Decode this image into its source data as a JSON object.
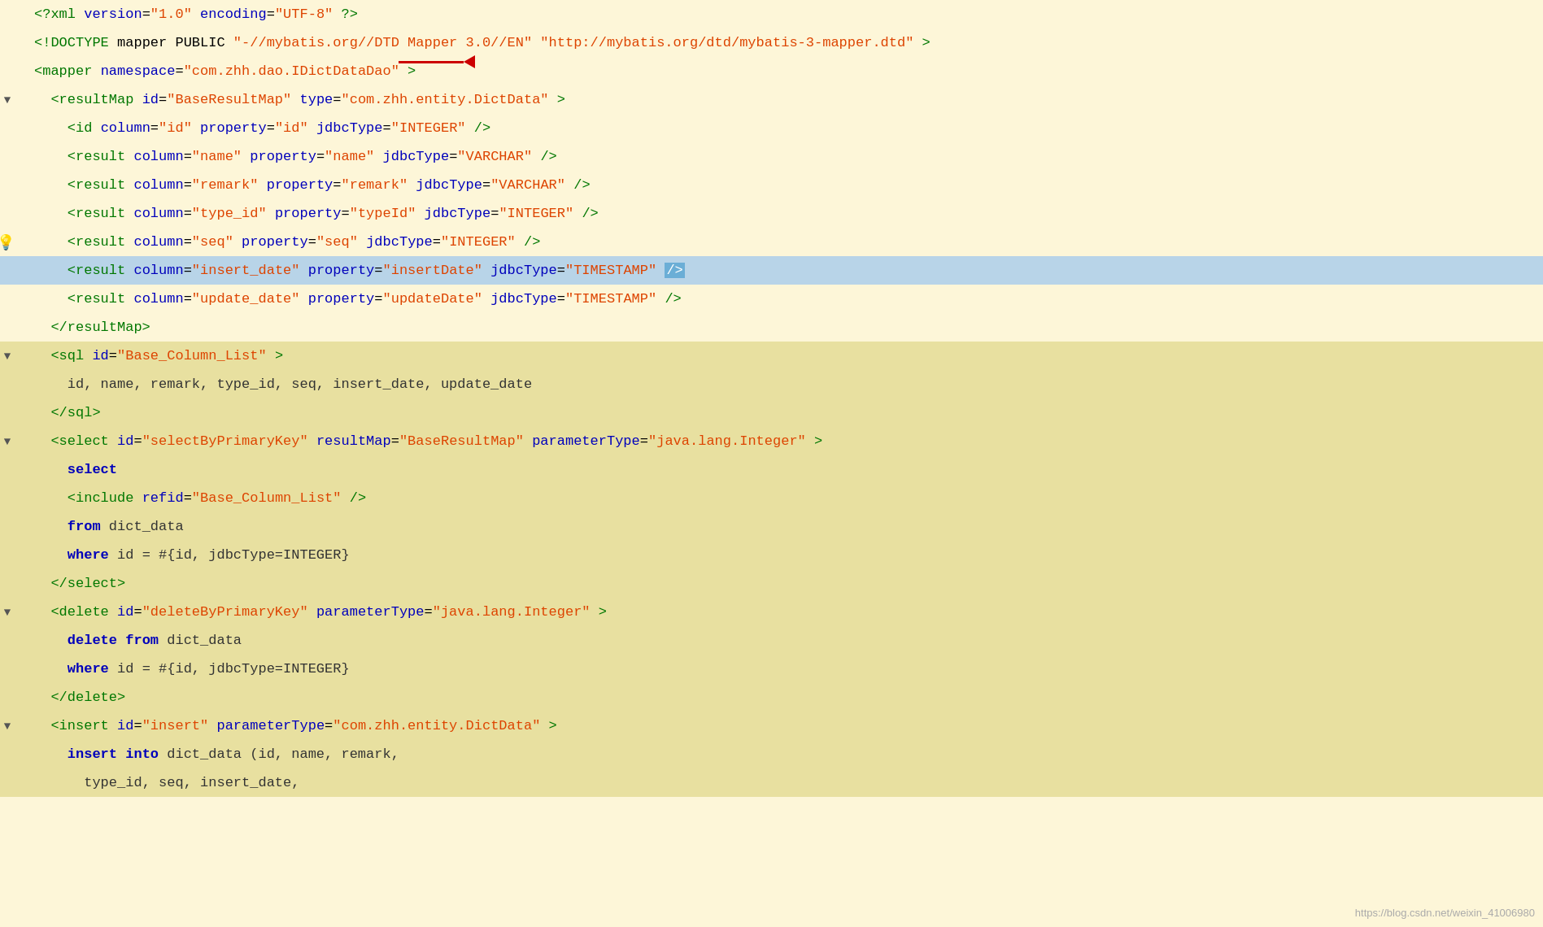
{
  "watermark": "https://blog.csdn.net/weixin_41006980",
  "lines": [
    {
      "id": 1,
      "gutter": "",
      "fold": "",
      "content": "<?xml version=\"1.0\" encoding=\"UTF-8\" ?>",
      "highlighted": false,
      "selected": false,
      "indent": 0,
      "hasBulb": false
    },
    {
      "id": 2,
      "gutter": "",
      "fold": "",
      "content": "<!DOCTYPE mapper PUBLIC \"-//mybatis.org//DTD Mapper 3.0//EN\" \"http://mybatis.org/dtd/mybatis-3-mapper.dtd\" >",
      "highlighted": false,
      "selected": false,
      "indent": 0,
      "hasBulb": false
    },
    {
      "id": 3,
      "gutter": "",
      "fold": "",
      "content": "<mapper namespace=\"com.zhh.dao.IDictDataDao\" >",
      "highlighted": false,
      "selected": false,
      "indent": 0,
      "hasBulb": false,
      "hasArrow": true
    },
    {
      "id": 4,
      "gutter": "▼",
      "fold": "",
      "content": "  <resultMap id=\"BaseResultMap\" type=\"com.zhh.entity.DictData\" >",
      "highlighted": false,
      "selected": false,
      "indent": 0,
      "hasBulb": false
    },
    {
      "id": 5,
      "gutter": "",
      "fold": "",
      "content": "    <id column=\"id\" property=\"id\" jdbcType=\"INTEGER\" />",
      "highlighted": false,
      "selected": false,
      "indent": 1,
      "hasBulb": false
    },
    {
      "id": 6,
      "gutter": "",
      "fold": "",
      "content": "    <result column=\"name\" property=\"name\" jdbcType=\"VARCHAR\" />",
      "highlighted": false,
      "selected": false,
      "indent": 1,
      "hasBulb": false
    },
    {
      "id": 7,
      "gutter": "",
      "fold": "",
      "content": "    <result column=\"remark\" property=\"remark\" jdbcType=\"VARCHAR\" />",
      "highlighted": false,
      "selected": false,
      "indent": 1,
      "hasBulb": false
    },
    {
      "id": 8,
      "gutter": "",
      "fold": "",
      "content": "    <result column=\"type_id\" property=\"typeId\" jdbcType=\"INTEGER\" />",
      "highlighted": false,
      "selected": false,
      "indent": 1,
      "hasBulb": false
    },
    {
      "id": 9,
      "gutter": "",
      "fold": "",
      "content": "    <result column=\"seq\" property=\"seq\" jdbcType=\"INTEGER\" />",
      "highlighted": false,
      "selected": false,
      "indent": 1,
      "hasBulb": true
    },
    {
      "id": 10,
      "gutter": "",
      "fold": "",
      "content": "    <result column=\"insert_date\" property=\"insertDate\" jdbcType=\"TIMESTAMP\" />",
      "highlighted": false,
      "selected": true,
      "indent": 1,
      "hasBulb": false,
      "blueEnd": true
    },
    {
      "id": 11,
      "gutter": "",
      "fold": "",
      "content": "    <result column=\"update_date\" property=\"updateDate\" jdbcType=\"TIMESTAMP\" />",
      "highlighted": false,
      "selected": false,
      "indent": 1,
      "hasBulb": false
    },
    {
      "id": 12,
      "gutter": "",
      "fold": "",
      "content": "  </resultMap>",
      "highlighted": false,
      "selected": false,
      "indent": 0,
      "hasBulb": false
    },
    {
      "id": 13,
      "gutter": "▼",
      "fold": "",
      "content": "  <sql id=\"Base_Column_List\" >",
      "highlighted": true,
      "selected": false,
      "indent": 0,
      "hasBulb": false
    },
    {
      "id": 14,
      "gutter": "",
      "fold": "",
      "content": "    id, name, remark, type_id, seq, insert_date, update_date",
      "highlighted": true,
      "selected": false,
      "indent": 1,
      "hasBulb": false
    },
    {
      "id": 15,
      "gutter": "",
      "fold": "",
      "content": "  </sql>",
      "highlighted": true,
      "selected": false,
      "indent": 0,
      "hasBulb": false
    },
    {
      "id": 16,
      "gutter": "▼",
      "fold": "",
      "content": "  <select id=\"selectByPrimaryKey\" resultMap=\"BaseResultMap\" parameterType=\"java.lang.Integer\" >",
      "highlighted": true,
      "selected": false,
      "indent": 0,
      "hasBulb": false
    },
    {
      "id": 17,
      "gutter": "",
      "fold": "",
      "content": "    select",
      "highlighted": true,
      "selected": false,
      "indent": 1,
      "hasBulb": false
    },
    {
      "id": 18,
      "gutter": "",
      "fold": "",
      "content": "    <include refid=\"Base_Column_List\" />",
      "highlighted": true,
      "selected": false,
      "indent": 1,
      "hasBulb": false
    },
    {
      "id": 19,
      "gutter": "",
      "fold": "",
      "content": "    from dict_data",
      "highlighted": true,
      "selected": false,
      "indent": 1,
      "hasBulb": false
    },
    {
      "id": 20,
      "gutter": "",
      "fold": "",
      "content": "    where id = #{id, jdbcType=INTEGER}",
      "highlighted": true,
      "selected": false,
      "indent": 1,
      "hasBulb": false
    },
    {
      "id": 21,
      "gutter": "",
      "fold": "",
      "content": "  </select>",
      "highlighted": true,
      "selected": false,
      "indent": 0,
      "hasBulb": false
    },
    {
      "id": 22,
      "gutter": "▼",
      "fold": "",
      "content": "  <delete id=\"deleteByPrimaryKey\" parameterType=\"java.lang.Integer\" >",
      "highlighted": true,
      "selected": false,
      "indent": 0,
      "hasBulb": false
    },
    {
      "id": 23,
      "gutter": "",
      "fold": "",
      "content": "    delete from dict_data",
      "highlighted": true,
      "selected": false,
      "indent": 1,
      "hasBulb": false
    },
    {
      "id": 24,
      "gutter": "",
      "fold": "",
      "content": "    where id = #{id, jdbcType=INTEGER}",
      "highlighted": true,
      "selected": false,
      "indent": 1,
      "hasBulb": false
    },
    {
      "id": 25,
      "gutter": "",
      "fold": "",
      "content": "  </delete>",
      "highlighted": true,
      "selected": false,
      "indent": 0,
      "hasBulb": false
    },
    {
      "id": 26,
      "gutter": "▼",
      "fold": "",
      "content": "  <insert id=\"insert\" parameterType=\"com.zhh.entity.DictData\" >",
      "highlighted": true,
      "selected": false,
      "indent": 0,
      "hasBulb": false
    },
    {
      "id": 27,
      "gutter": "",
      "fold": "",
      "content": "    insert into dict_data (id, name, remark,",
      "highlighted": true,
      "selected": false,
      "indent": 1,
      "hasBulb": false
    },
    {
      "id": 28,
      "gutter": "",
      "fold": "",
      "content": "      type_id, seq, insert_date,",
      "highlighted": true,
      "selected": false,
      "indent": 2,
      "hasBulb": false
    }
  ]
}
